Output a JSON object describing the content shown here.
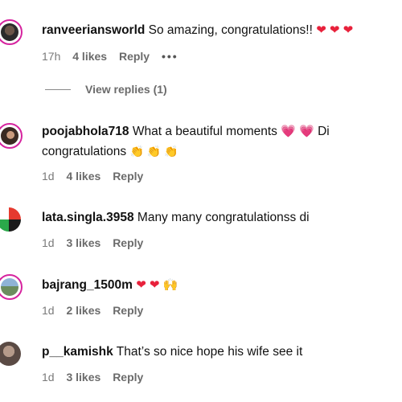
{
  "comments": [
    {
      "username": "ranveeriansworld",
      "text": "So amazing, congratulations!!",
      "emoji": "❤ ❤ ❤",
      "time": "17h",
      "likes": "4 likes",
      "reply": "Reply",
      "more": "•••",
      "view_replies": "View replies (1)"
    },
    {
      "username": "poojabhola718",
      "text": "What a beautiful moments",
      "emoji_a": "💗 💗",
      "text2": "Di congratulations",
      "emoji_b": "👏 👏 👏",
      "time": "1d",
      "likes": "4 likes",
      "reply": "Reply"
    },
    {
      "username": "lata.singla.3958",
      "text": "Many many congratulationss di",
      "time": "1d",
      "likes": "3 likes",
      "reply": "Reply"
    },
    {
      "username": "bajrang_1500m",
      "emoji": "❤ ❤ 🙌",
      "time": "1d",
      "likes": "2 likes",
      "reply": "Reply"
    },
    {
      "username": "p__kamishk",
      "text": "That’s so nice hope his wife see it",
      "time": "1d",
      "likes": "3 likes",
      "reply": "Reply"
    }
  ]
}
